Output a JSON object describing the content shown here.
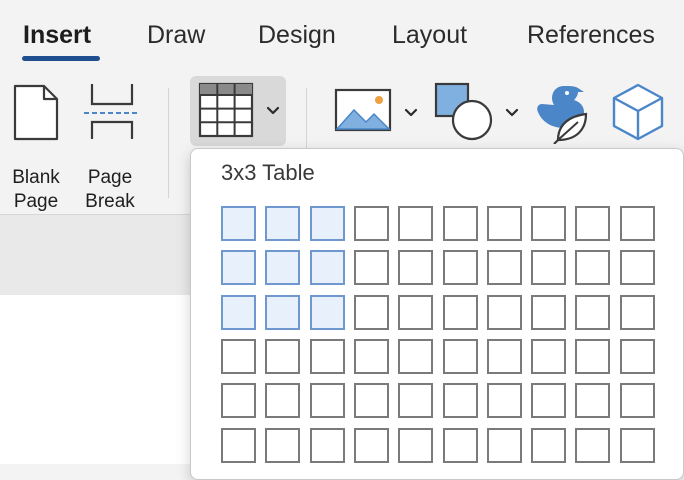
{
  "tabs": [
    {
      "label": "Insert",
      "active": true
    },
    {
      "label": "Draw",
      "active": false
    },
    {
      "label": "Design",
      "active": false
    },
    {
      "label": "Layout",
      "active": false
    },
    {
      "label": "References",
      "active": false
    }
  ],
  "ribbon": {
    "blank_page": {
      "line1": "Blank",
      "line2": "Page",
      "icon": "blank-page-icon"
    },
    "page_break": {
      "line1": "Page",
      "line2": "Break",
      "icon": "page-break-icon"
    },
    "table": {
      "icon": "table-grid-icon",
      "expanded": true
    },
    "pictures": {
      "icon": "picture-icon"
    },
    "shapes": {
      "icon": "shapes-icon"
    },
    "icons": {
      "icon": "duck-icon"
    },
    "models_3d": {
      "icon": "cube-icon"
    }
  },
  "table_dropdown": {
    "title": "3x3 Table",
    "columns": 10,
    "rows_visible": 6,
    "selected_rows": 3,
    "selected_cols": 3
  },
  "colors": {
    "accent": "#1f4f8f",
    "selection_fill": "#e8f0fb",
    "selection_border": "#6f98cf",
    "icon_blue": "#4a86c8"
  }
}
